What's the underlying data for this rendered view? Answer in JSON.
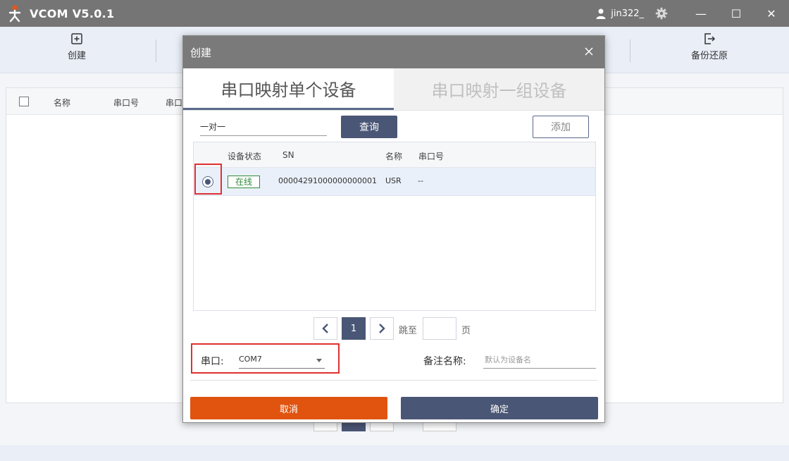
{
  "app": {
    "title": "VCOM V5.0.1",
    "user": "jin322_"
  },
  "window_controls": {
    "minimize": "—",
    "maximize": "☐",
    "close": "✕"
  },
  "toolbar": {
    "create_label": "创建",
    "backup_label": "备份还原"
  },
  "main_table": {
    "columns": [
      "名称",
      "串口号",
      "串口"
    ]
  },
  "modal": {
    "title": "创建",
    "tabs": [
      {
        "label": "串口映射单个设备",
        "active": true
      },
      {
        "label": "串口映射一组设备",
        "active": false
      }
    ],
    "search_value": "一对一",
    "query_label": "查询",
    "add_label": "添加",
    "table": {
      "columns": [
        "设备状态",
        "SN",
        "名称",
        "串口号"
      ],
      "rows": [
        {
          "status": "在线",
          "sn": "00004291000000000001",
          "name": "USR",
          "port": "--",
          "selected": true
        }
      ]
    },
    "pager": {
      "current": "1",
      "goto": "跳至",
      "page": "页"
    },
    "port_label": "串口:",
    "port_value": "COM7",
    "alias_label": "备注名称:",
    "alias_placeholder": "默认为设备名",
    "cancel_label": "取消",
    "ok_label": "确定"
  },
  "colors": {
    "primary": "#4a5675",
    "cancel": "#e0540f",
    "online": "#2e8b3a",
    "highlight": "#e03030",
    "titlebar": "#757575"
  }
}
